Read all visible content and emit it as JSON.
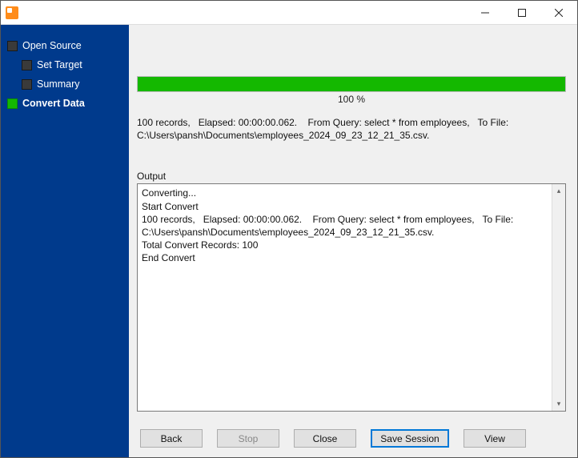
{
  "window": {
    "title": ""
  },
  "sidebar": {
    "items": [
      {
        "label": "Open Source",
        "active": false,
        "child": false
      },
      {
        "label": "Set Target",
        "active": false,
        "child": true
      },
      {
        "label": "Summary",
        "active": false,
        "child": true
      },
      {
        "label": "Convert Data",
        "active": true,
        "child": false
      }
    ]
  },
  "progress": {
    "percent_label": "100 %",
    "percent_value": 100
  },
  "summary": "100 records,   Elapsed: 00:00:00.062.    From Query: select * from employees,   To File: C:\\Users\\pansh\\Documents\\employees_2024_09_23_12_21_35.csv.",
  "output_label": "Output",
  "output_lines": [
    "Converting...",
    "Start Convert",
    "100 records,   Elapsed: 00:00:00.062.    From Query: select * from employees,   To File: C:\\Users\\pansh\\Documents\\employees_2024_09_23_12_21_35.csv.",
    "Total Convert Records: 100",
    "End Convert"
  ],
  "buttons": {
    "back": "Back",
    "stop": "Stop",
    "close": "Close",
    "save_session": "Save Session",
    "view": "View"
  },
  "colors": {
    "sidebar_bg": "#003a8c",
    "progress_fill": "#14b800",
    "primary_border": "#0078d7"
  }
}
